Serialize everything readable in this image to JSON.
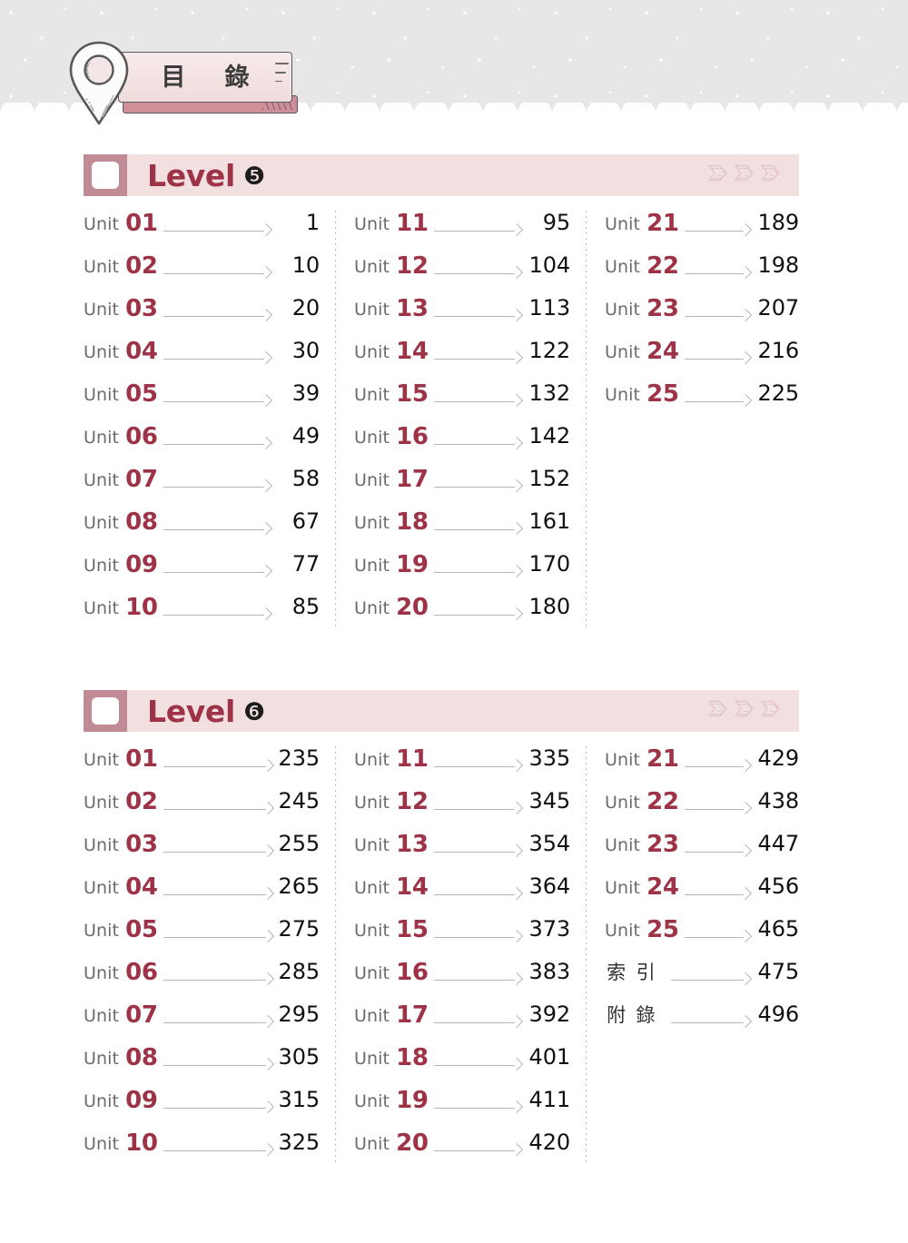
{
  "page": {
    "title": "目　錄",
    "title_plain": "目 錄"
  },
  "colors": {
    "accent_red": "#9e3347",
    "band_pink": "#f2dfe0",
    "badge_rose": "#c08b94",
    "page_number": "#111111",
    "label_gray": "#6b6b6b",
    "arrow_gray": "#b6b6b6",
    "top_band_gray": "#e8e6e6"
  },
  "sections": [
    {
      "id": "level-5",
      "word": "Level",
      "number": "❺",
      "number_plain": "5",
      "columns": [
        {
          "rows": [
            {
              "kind": "unit",
              "prefix": "Unit",
              "num": "01",
              "page": "1"
            },
            {
              "kind": "unit",
              "prefix": "Unit",
              "num": "02",
              "page": "10"
            },
            {
              "kind": "unit",
              "prefix": "Unit",
              "num": "03",
              "page": "20"
            },
            {
              "kind": "unit",
              "prefix": "Unit",
              "num": "04",
              "page": "30"
            },
            {
              "kind": "unit",
              "prefix": "Unit",
              "num": "05",
              "page": "39"
            },
            {
              "kind": "unit",
              "prefix": "Unit",
              "num": "06",
              "page": "49"
            },
            {
              "kind": "unit",
              "prefix": "Unit",
              "num": "07",
              "page": "58"
            },
            {
              "kind": "unit",
              "prefix": "Unit",
              "num": "08",
              "page": "67"
            },
            {
              "kind": "unit",
              "prefix": "Unit",
              "num": "09",
              "page": "77"
            },
            {
              "kind": "unit",
              "prefix": "Unit",
              "num": "10",
              "page": "85"
            }
          ]
        },
        {
          "rows": [
            {
              "kind": "unit",
              "prefix": "Unit",
              "num": "11",
              "page": "95"
            },
            {
              "kind": "unit",
              "prefix": "Unit",
              "num": "12",
              "page": "104"
            },
            {
              "kind": "unit",
              "prefix": "Unit",
              "num": "13",
              "page": "113"
            },
            {
              "kind": "unit",
              "prefix": "Unit",
              "num": "14",
              "page": "122"
            },
            {
              "kind": "unit",
              "prefix": "Unit",
              "num": "15",
              "page": "132"
            },
            {
              "kind": "unit",
              "prefix": "Unit",
              "num": "16",
              "page": "142"
            },
            {
              "kind": "unit",
              "prefix": "Unit",
              "num": "17",
              "page": "152"
            },
            {
              "kind": "unit",
              "prefix": "Unit",
              "num": "18",
              "page": "161"
            },
            {
              "kind": "unit",
              "prefix": "Unit",
              "num": "19",
              "page": "170"
            },
            {
              "kind": "unit",
              "prefix": "Unit",
              "num": "20",
              "page": "180"
            }
          ]
        },
        {
          "rows": [
            {
              "kind": "unit",
              "prefix": "Unit",
              "num": "21",
              "page": "189"
            },
            {
              "kind": "unit",
              "prefix": "Unit",
              "num": "22",
              "page": "198"
            },
            {
              "kind": "unit",
              "prefix": "Unit",
              "num": "23",
              "page": "207"
            },
            {
              "kind": "unit",
              "prefix": "Unit",
              "num": "24",
              "page": "216"
            },
            {
              "kind": "unit",
              "prefix": "Unit",
              "num": "25",
              "page": "225"
            }
          ]
        }
      ]
    },
    {
      "id": "level-6",
      "word": "Level",
      "number": "❻",
      "number_plain": "6",
      "columns": [
        {
          "rows": [
            {
              "kind": "unit",
              "prefix": "Unit",
              "num": "01",
              "page": "235"
            },
            {
              "kind": "unit",
              "prefix": "Unit",
              "num": "02",
              "page": "245"
            },
            {
              "kind": "unit",
              "prefix": "Unit",
              "num": "03",
              "page": "255"
            },
            {
              "kind": "unit",
              "prefix": "Unit",
              "num": "04",
              "page": "265"
            },
            {
              "kind": "unit",
              "prefix": "Unit",
              "num": "05",
              "page": "275"
            },
            {
              "kind": "unit",
              "prefix": "Unit",
              "num": "06",
              "page": "285"
            },
            {
              "kind": "unit",
              "prefix": "Unit",
              "num": "07",
              "page": "295"
            },
            {
              "kind": "unit",
              "prefix": "Unit",
              "num": "08",
              "page": "305"
            },
            {
              "kind": "unit",
              "prefix": "Unit",
              "num": "09",
              "page": "315"
            },
            {
              "kind": "unit",
              "prefix": "Unit",
              "num": "10",
              "page": "325"
            }
          ]
        },
        {
          "rows": [
            {
              "kind": "unit",
              "prefix": "Unit",
              "num": "11",
              "page": "335"
            },
            {
              "kind": "unit",
              "prefix": "Unit",
              "num": "12",
              "page": "345"
            },
            {
              "kind": "unit",
              "prefix": "Unit",
              "num": "13",
              "page": "354"
            },
            {
              "kind": "unit",
              "prefix": "Unit",
              "num": "14",
              "page": "364"
            },
            {
              "kind": "unit",
              "prefix": "Unit",
              "num": "15",
              "page": "373"
            },
            {
              "kind": "unit",
              "prefix": "Unit",
              "num": "16",
              "page": "383"
            },
            {
              "kind": "unit",
              "prefix": "Unit",
              "num": "17",
              "page": "392"
            },
            {
              "kind": "unit",
              "prefix": "Unit",
              "num": "18",
              "page": "401"
            },
            {
              "kind": "unit",
              "prefix": "Unit",
              "num": "19",
              "page": "411"
            },
            {
              "kind": "unit",
              "prefix": "Unit",
              "num": "20",
              "page": "420"
            }
          ]
        },
        {
          "rows": [
            {
              "kind": "unit",
              "prefix": "Unit",
              "num": "21",
              "page": "429"
            },
            {
              "kind": "unit",
              "prefix": "Unit",
              "num": "22",
              "page": "438"
            },
            {
              "kind": "unit",
              "prefix": "Unit",
              "num": "23",
              "page": "447"
            },
            {
              "kind": "unit",
              "prefix": "Unit",
              "num": "24",
              "page": "456"
            },
            {
              "kind": "unit",
              "prefix": "Unit",
              "num": "25",
              "page": "465"
            },
            {
              "kind": "cjk",
              "label": "索引",
              "page": "475"
            },
            {
              "kind": "cjk",
              "label": "附錄",
              "page": "496"
            }
          ]
        }
      ]
    }
  ],
  "icons": {
    "pin": "map-pin-icon",
    "deco": "stacked-pages-icon"
  }
}
